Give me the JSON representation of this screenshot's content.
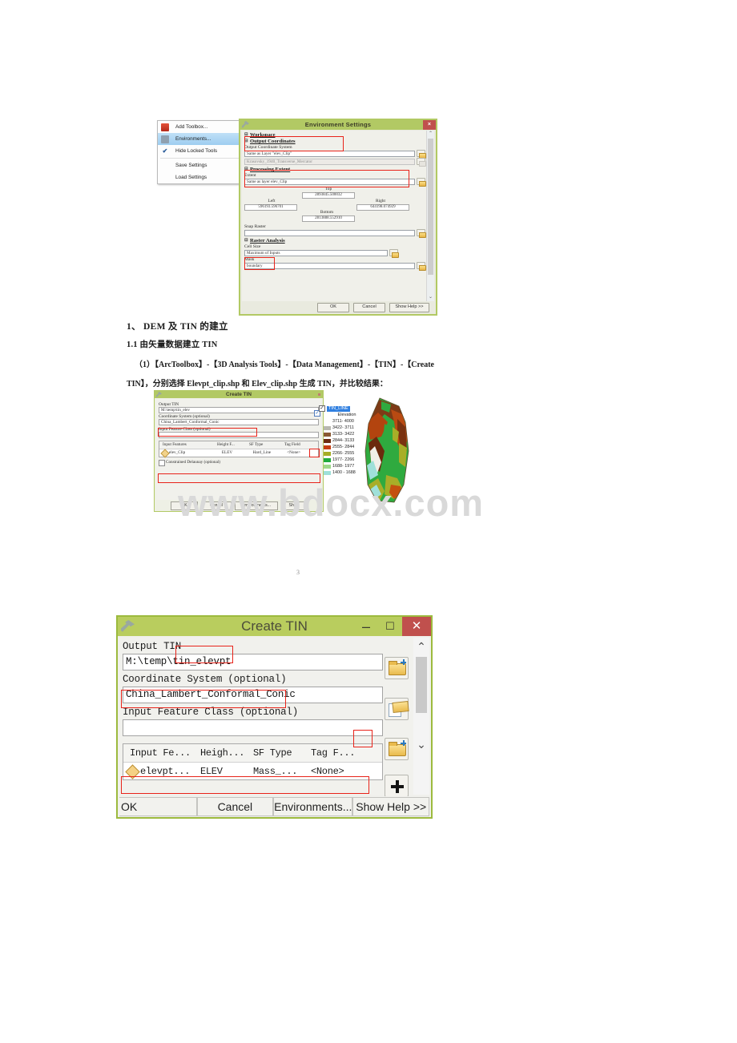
{
  "figure1": {
    "context_menu": {
      "items": [
        {
          "label": "Add Toolbox...",
          "icon": "toolbox-icon",
          "selected": false,
          "checked": false
        },
        {
          "label": "Environments...",
          "icon": "environments-icon",
          "selected": true,
          "checked": false
        },
        {
          "label": "Hide Locked Tools",
          "icon": "check-icon",
          "selected": false,
          "checked": true
        },
        {
          "label": "Save Settings",
          "icon": "none",
          "selected": false,
          "checked": false
        },
        {
          "label": "Load Settings",
          "icon": "none",
          "selected": false,
          "checked": false
        }
      ]
    },
    "dialog": {
      "title": "Environment Settings",
      "close_label": "×",
      "groups": {
        "workspace": "Workspace",
        "output_coordinates": "Output Coordinates",
        "processing_extent": "Processing Extent",
        "raster_analysis": "Raster Analysis"
      },
      "output_coordinate_system_label": "Output Coordinate System",
      "output_coordinate_system_value": "Same as Layer \"elev_Clip\"",
      "projection_value": "Krasovsky_1940_Transverse_Mercator",
      "extent_label": "Extent",
      "extent_value": "Same as layer elev_Clip",
      "extent_fields": {
        "top_label": "Top",
        "top_value": "2893845.500032",
        "left_label": "Left",
        "left_value": "596193.596701",
        "right_label": "Right",
        "right_value": "644198.074929",
        "bottom_label": "Bottom",
        "bottom_value": "2813888.552910"
      },
      "snap_raster_label": "Snap Raster",
      "snap_raster_value": "",
      "cell_size_label": "Cell Size",
      "cell_size_value": "Maximum of Inputs",
      "mask_label": "Mask",
      "mask_value": "boundary",
      "buttons": {
        "ok": "OK",
        "cancel": "Cancel",
        "show_help": "Show Help >>"
      },
      "title_bar_color": "#b2c964",
      "close_button_color": "#c0504d",
      "highlight_box_color": "#e8231a"
    }
  },
  "body_text": {
    "heading1": "1、   DEM 及 TIN 的建立",
    "heading2": "1.1  由矢量数据建立 TIN",
    "para_line1": "（1）【ArcToolbox】-【3D Analysis Tools】-【Data Management】-【TIN】-【Create",
    "para_line2": "TIN】，分别选择 Elevpt_clip.shp 和 Elev_clip.shp 生成 TIN，并比较结果：",
    "page_number": "3",
    "watermark": "www.bdocx.com"
  },
  "figure2": {
    "dialog": {
      "title": "Create TIN",
      "output_tin_label": "Output TIN",
      "output_tin_value": "M:\\temp\\tin_elev",
      "coordinate_system_label": "Coordinate System (optional)",
      "coordinate_system_value": "China_Lambert_Conformal_Conic",
      "input_feature_class_label": "Input Feature Class (optional)",
      "input_feature_class_value": "",
      "table_headers": [
        "Input Features",
        "Height F...",
        "SF Type",
        "Tag Field"
      ],
      "table_row": [
        "elev_Clip",
        "ELEV",
        "Hard_Line",
        "<None>"
      ],
      "checkbox_label": "Constrained Delaunay (optional)",
      "buttons": {
        "ok": "OK",
        "cancel": "Cancel",
        "environments": "Environments...",
        "show_help": "Show"
      }
    },
    "legend": {
      "layer_name": "TIN_LINE",
      "title": "Elevation",
      "classes": [
        {
          "range": "3711- 4000",
          "color": "transparent"
        },
        {
          "range": "3422- 3711",
          "color": "#b8b8b0"
        },
        {
          "range": "3133- 3422",
          "color": "#8a5a33"
        },
        {
          "range": "2844- 3133",
          "color": "#6d2c10"
        },
        {
          "range": "2555- 2844",
          "color": "#c63f12"
        },
        {
          "range": "2266- 2555",
          "color": "#a6ad25"
        },
        {
          "range": "1977- 2266",
          "color": "#1faa3c"
        },
        {
          "range": "1688- 1977",
          "color": "#9ed88a"
        },
        {
          "range": "1400 - 1688",
          "color": "#9fe0d9"
        }
      ]
    },
    "map_alt": "tin-elevation-map"
  },
  "figure3": {
    "title": "Create TIN",
    "window_buttons": {
      "minimize": "–",
      "maximize": "☐",
      "close": "✕"
    },
    "output_tin_label": "Output TIN",
    "output_tin_prefix": "M:\\temp\\",
    "output_tin_highlight": "tin_elevpt",
    "coordinate_system_label": "Coordinate System (optional)",
    "coordinate_system_value": "China_Lambert_Conformal_Conic",
    "input_feature_class_label": "Input Feature Class (optional)",
    "input_feature_class_value": "",
    "dropdown_caret": "▼",
    "table_headers": [
      "Input Fe...",
      "Heigh...",
      "SF Type",
      "Tag F..."
    ],
    "table_row": [
      "elevpt...",
      "ELEV",
      "Mass_...",
      "<None>"
    ],
    "side_buttons": [
      "open-folder-icon",
      "edit-properties-icon",
      "open-folder-icon",
      "add-plus-icon",
      "move-down-icon"
    ],
    "scroll": {
      "up": "⌃",
      "down": "⌄"
    },
    "buttons": {
      "ok": "OK",
      "cancel": "Cancel",
      "environments": "Environments...",
      "show_help": "Show Help >>"
    },
    "title_bar_color": "#b9cd5e",
    "close_button_color": "#c0504d",
    "highlight_box_color": "#e8231a"
  }
}
